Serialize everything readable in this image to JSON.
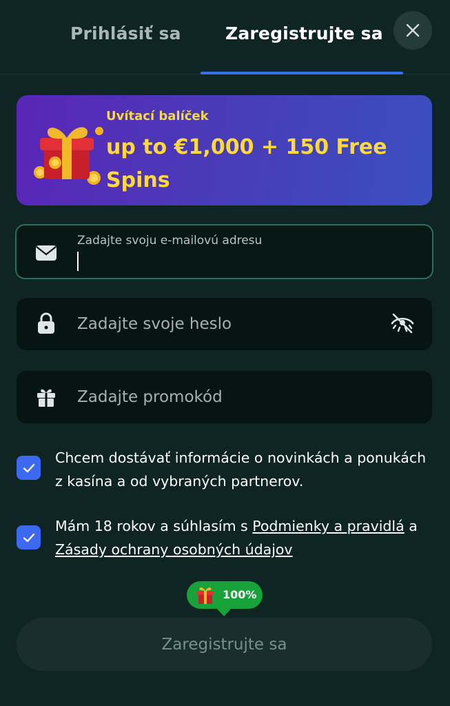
{
  "tabs": {
    "login_label": "Prihlásiť sa",
    "register_label": "Zaregistrujte sa"
  },
  "banner": {
    "subtitle": "Uvítací balíček",
    "title": "up to €1,000 + 150 Free Spins"
  },
  "email": {
    "label": "Zadajte svoju e-mailovú adresu",
    "value": ""
  },
  "password": {
    "placeholder": "Zadajte svoje heslo"
  },
  "promo": {
    "placeholder": "Zadajte promokód"
  },
  "consents": {
    "news_text": "Chcem dostávať informácie o novinkách a ponukách z kasína a od vybraných partnerov.",
    "news_checked": true,
    "age_prefix": "Mám 18 rokov a súhlasím s ",
    "age_link_terms": "Podmienky a pravidlá",
    "age_and": " a ",
    "age_link_privacy": "Zásady ochrany osobných údajov",
    "age_checked": true
  },
  "progress": {
    "label": "100%",
    "value": 100
  },
  "submit_label": "Zaregistrujte sa",
  "colors": {
    "background": "#0f2523",
    "accent": "#3d68f0",
    "banner_text": "#ffd93a",
    "progress_green": "#17a33a"
  },
  "icons": {
    "close": "close-icon",
    "email": "envelope-icon",
    "password": "lock-icon",
    "visibility": "eye-slash-icon",
    "promo": "gift-icon",
    "checkbox": "checkmark-icon"
  }
}
